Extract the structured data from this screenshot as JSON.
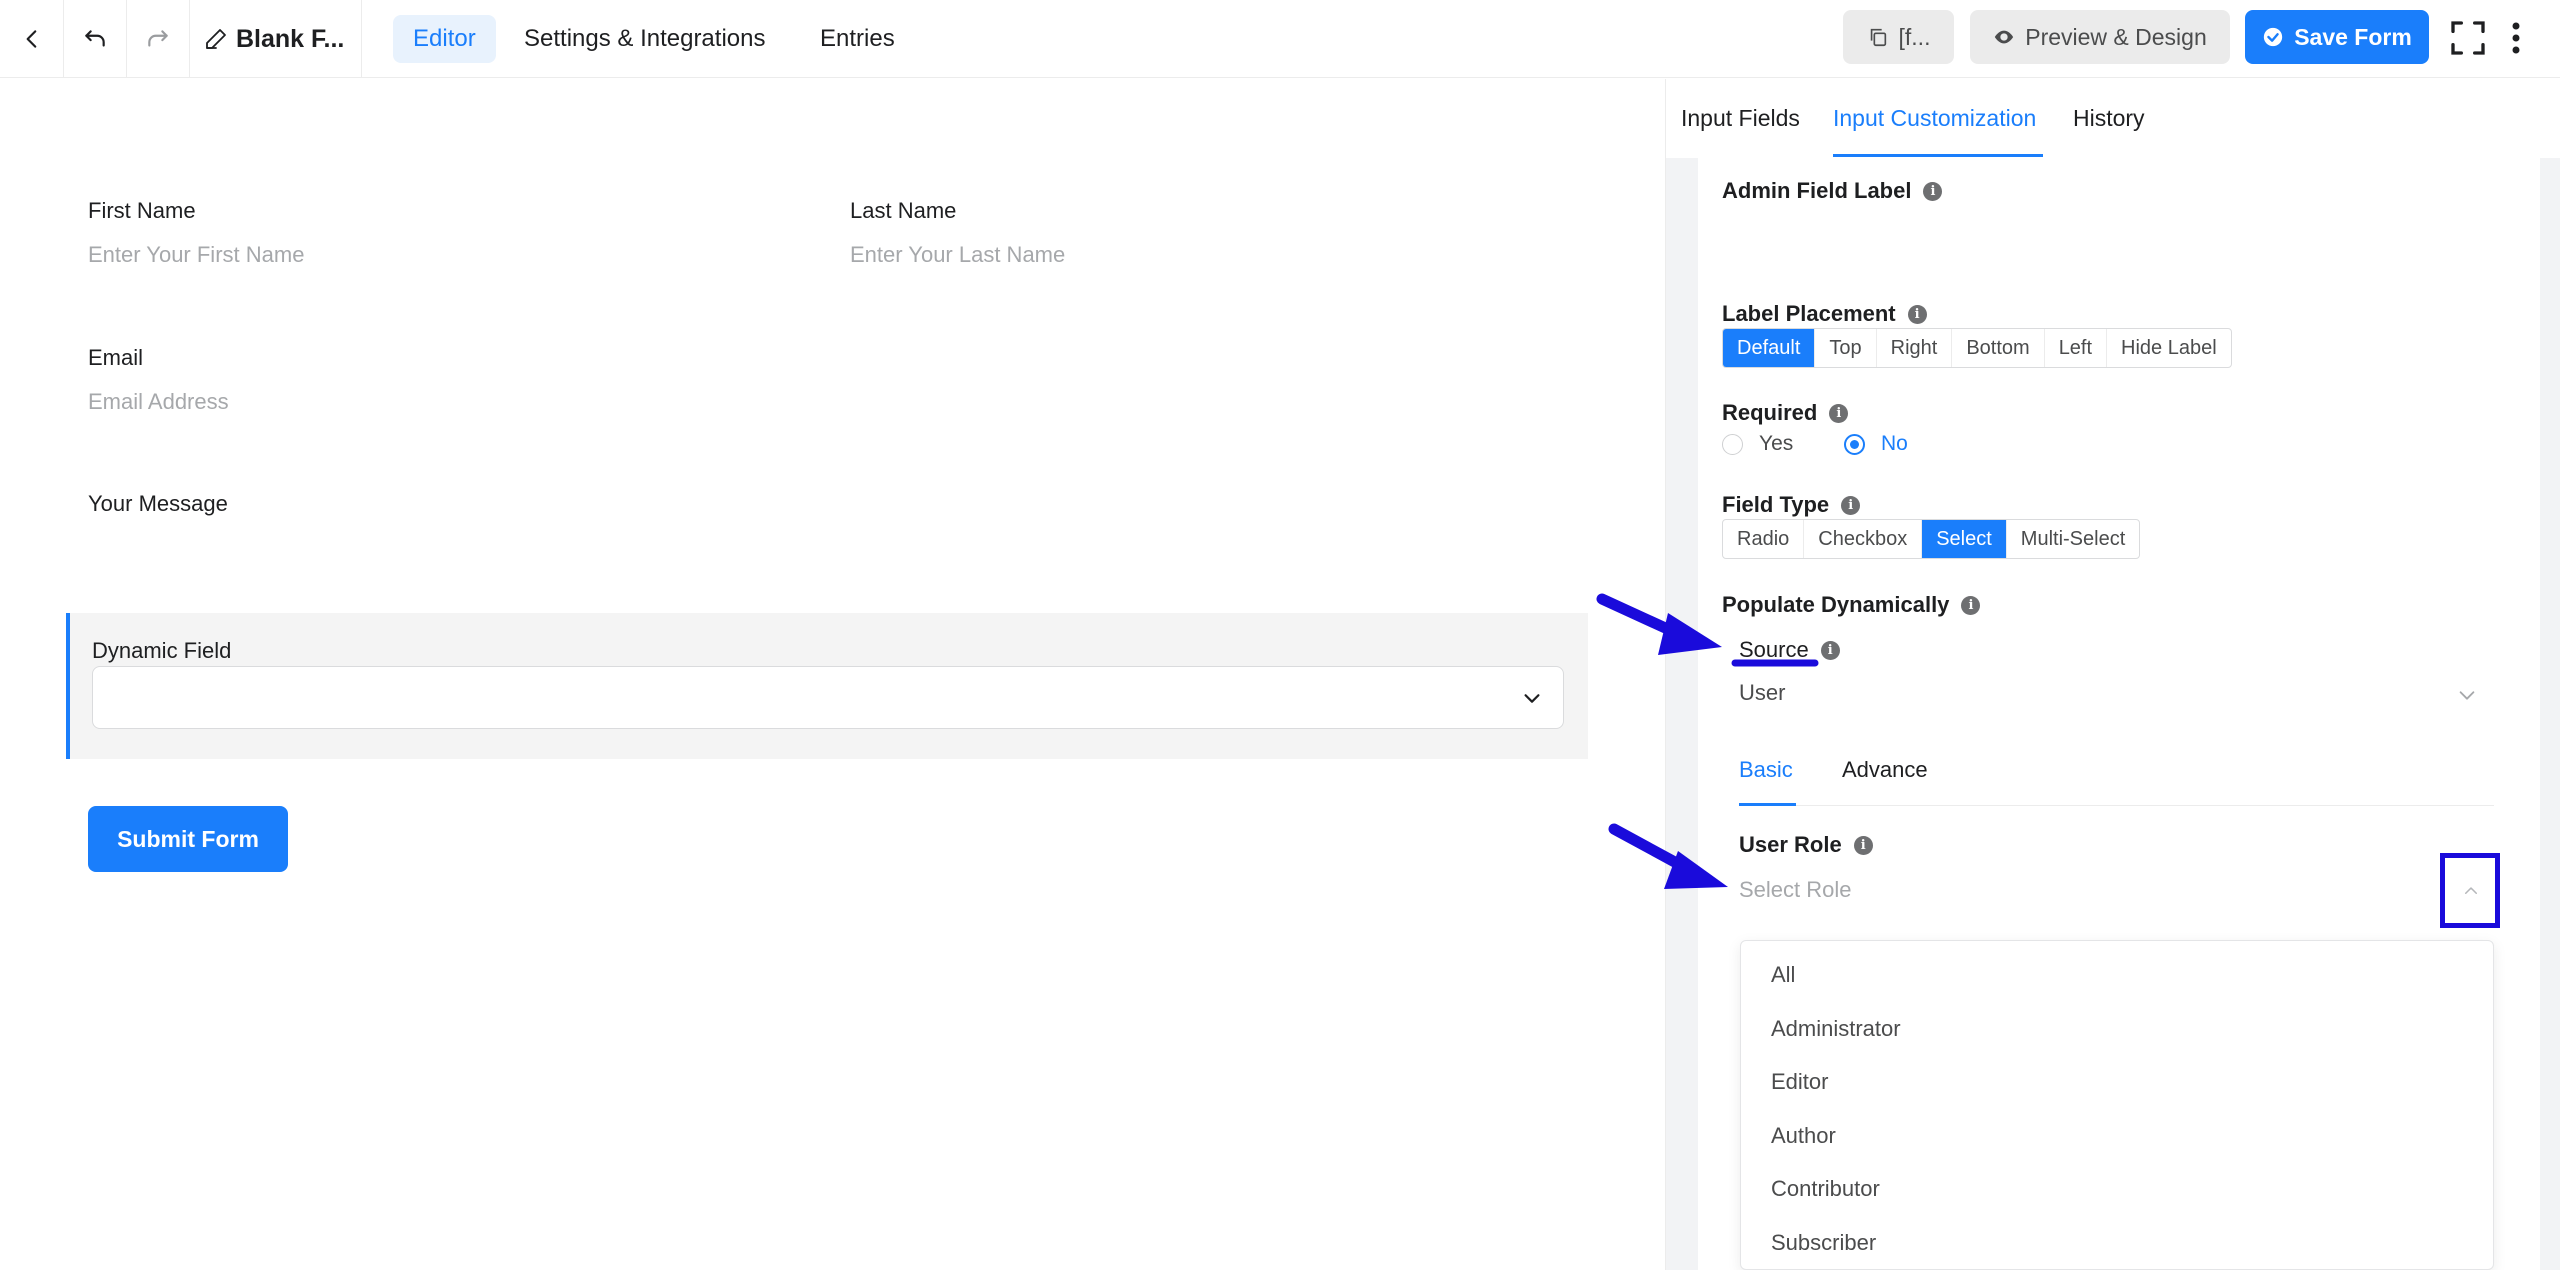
{
  "topbar": {
    "form_name": "Blank F...",
    "tabs": [
      "Editor",
      "Settings & Integrations",
      "Entries"
    ],
    "shortcode_label": "[f...",
    "preview_label": "Preview & Design",
    "save_label": "Save Form"
  },
  "form": {
    "first_name_label": "First Name",
    "first_name_placeholder": "Enter Your First Name",
    "last_name_label": "Last Name",
    "last_name_placeholder": "Enter Your Last Name",
    "email_label": "Email",
    "email_placeholder": "Email Address",
    "message_label": "Your Message",
    "dynamic_label": "Dynamic Field",
    "submit_label": "Submit Form"
  },
  "panel": {
    "tabs": [
      "Input Fields",
      "Input Customization",
      "History"
    ],
    "admin_label": "Admin Field Label",
    "label_placement": {
      "title": "Label Placement",
      "options": [
        "Default",
        "Top",
        "Right",
        "Bottom",
        "Left",
        "Hide Label"
      ],
      "selected": "Default"
    },
    "required": {
      "title": "Required",
      "options": [
        "Yes",
        "No"
      ],
      "selected": "No"
    },
    "field_type": {
      "title": "Field Type",
      "options": [
        "Radio",
        "Checkbox",
        "Select",
        "Multi-Select"
      ],
      "selected": "Select"
    },
    "populate_title": "Populate Dynamically",
    "source_label": "Source",
    "source_value": "User",
    "sub_tabs": [
      "Basic",
      "Advance"
    ],
    "user_role_label": "User Role",
    "user_role_placeholder": "Select Role",
    "role_options": [
      "All",
      "Administrator",
      "Editor",
      "Author",
      "Contributor",
      "Subscriber"
    ]
  },
  "colors": {
    "accent": "#1a7efb",
    "annotation": "#1a0bdb"
  }
}
